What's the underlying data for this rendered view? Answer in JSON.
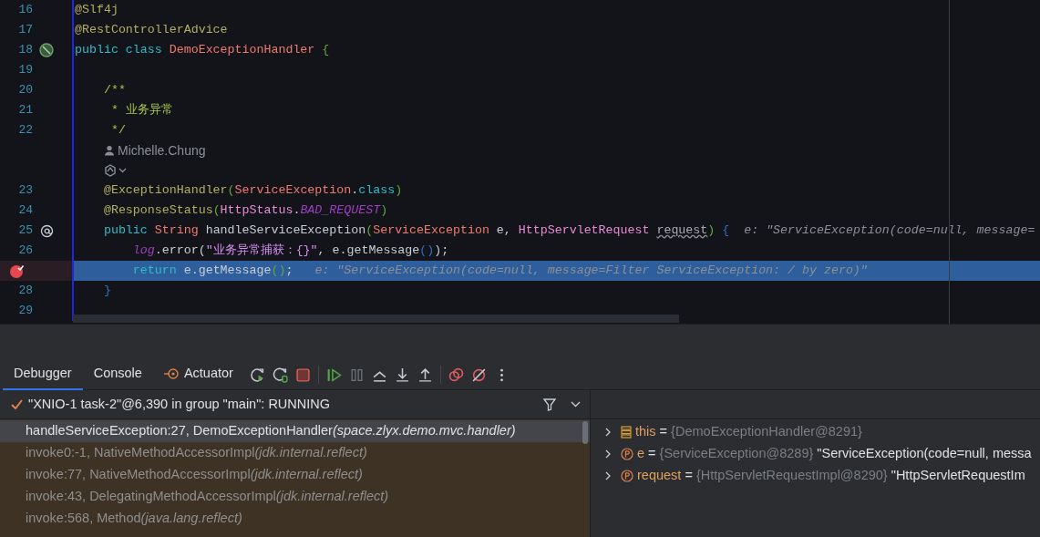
{
  "editor": {
    "lines": [
      {
        "kind": "code",
        "number": "16",
        "tokens": [
          {
            "text": "@Slf4j",
            "kind": "annotation"
          }
        ]
      },
      {
        "kind": "code",
        "number": "17",
        "tokens": [
          {
            "text": "@RestControllerAdvice",
            "kind": "annotation"
          }
        ]
      },
      {
        "kind": "class-declaration",
        "number": "18",
        "tokens": [
          {
            "text": "public class ",
            "kind": "keyword"
          },
          {
            "text": "DemoExceptionHandler",
            "kind": "type"
          },
          {
            "text": " {",
            "kind": "brace"
          }
        ]
      },
      {
        "kind": "code",
        "number": "19"
      },
      {
        "kind": "code",
        "number": "20",
        "tokens": [
          {
            "text": "    /**",
            "kind": "comment"
          }
        ]
      },
      {
        "kind": "code",
        "number": "21",
        "tokens": [
          {
            "text": "     * 业务异常",
            "kind": "comment"
          }
        ]
      },
      {
        "kind": "code",
        "number": "22",
        "tokens": [
          {
            "text": "     */",
            "kind": "comment"
          }
        ]
      },
      {
        "kind": "author",
        "text": "Michelle.Chung"
      },
      {
        "kind": "ai-hint"
      },
      {
        "kind": "code",
        "number": "23",
        "tokens": [
          {
            "text": "    @ExceptionHandler",
            "kind": "annotation"
          },
          {
            "text": "(",
            "kind": "brace"
          },
          {
            "text": "ServiceException",
            "kind": "type"
          },
          {
            "text": ".",
            "kind": "plain"
          },
          {
            "text": "class",
            "kind": "keyword"
          },
          {
            "text": ")",
            "kind": "brace"
          }
        ]
      },
      {
        "kind": "code",
        "number": "24",
        "tokens": [
          {
            "text": "    @ResponseStatus",
            "kind": "annotation"
          },
          {
            "text": "(",
            "kind": "brace"
          },
          {
            "text": "HttpStatus",
            "kind": "type2"
          },
          {
            "text": ".",
            "kind": "plain"
          },
          {
            "text": "BAD_REQUEST",
            "kind": "constant"
          },
          {
            "text": ")",
            "kind": "brace"
          }
        ]
      },
      {
        "kind": "request-mapping",
        "number": "25",
        "tokens": [
          {
            "text": "    public ",
            "kind": "keyword"
          },
          {
            "text": "String",
            "kind": "type"
          },
          {
            "text": " handleServiceException",
            "kind": "plain"
          },
          {
            "text": "(",
            "kind": "brace"
          },
          {
            "text": "ServiceException",
            "kind": "type"
          },
          {
            "text": " e, ",
            "kind": "plain"
          },
          {
            "text": "HttpServletRequest ",
            "kind": "type2"
          },
          {
            "text": "request",
            "kind": "unused"
          },
          {
            "text": ")",
            "kind": "brace"
          },
          {
            "text": " {",
            "kind": "brace2"
          },
          {
            "text": "  e: \"ServiceException(code=null, message=",
            "kind": "hint"
          }
        ]
      },
      {
        "kind": "code",
        "number": "26",
        "tokens": [
          {
            "text": "        log",
            "kind": "constant"
          },
          {
            "text": ".error(",
            "kind": "plain"
          },
          {
            "text": "\"业务异常捕获：{}\"",
            "kind": "string"
          },
          {
            "text": ", e.getMessage",
            "kind": "plain"
          },
          {
            "text": "()",
            "kind": "brace2"
          },
          {
            "text": ");",
            "kind": "plain"
          }
        ]
      },
      {
        "kind": "code",
        "current": true,
        "breakpoint": true,
        "tokens": [
          {
            "text": "        return",
            "kind": "keyword"
          },
          {
            "text": " e.getMessage",
            "kind": "plain"
          },
          {
            "text": "()",
            "kind": "brace"
          },
          {
            "text": ";",
            "kind": "plain"
          },
          {
            "text": "   e: \"ServiceException(code=null, message=Filter ServiceException: / by zero)\"",
            "kind": "hint"
          }
        ]
      },
      {
        "kind": "code",
        "number": "28",
        "tokens": [
          {
            "text": "    }",
            "kind": "brace2"
          }
        ]
      },
      {
        "kind": "code",
        "number": "29"
      }
    ]
  },
  "tool_window": {
    "tabs": [
      {
        "label": "Debugger",
        "selected": true
      },
      {
        "label": "Console",
        "selected": false
      },
      {
        "label": "Actuator",
        "selected": false
      }
    ],
    "thread": "\"XNIO-1 task-2\"@6,390 in group \"main\": RUNNING",
    "frames": [
      {
        "method": "handleServiceException:27, DemoExceptionHandler",
        "package": "(space.zlyx.demo.mvc.handler)",
        "selected": true,
        "library": false
      },
      {
        "method": "invoke0:-1, NativeMethodAccessorImpl",
        "package": "(jdk.internal.reflect)",
        "selected": false,
        "library": true
      },
      {
        "method": "invoke:77, NativeMethodAccessorImpl",
        "package": "(jdk.internal.reflect)",
        "selected": false,
        "library": true
      },
      {
        "method": "invoke:43, DelegatingMethodAccessorImpl",
        "package": "(jdk.internal.reflect)",
        "selected": false,
        "library": true
      },
      {
        "method": "invoke:568, Method",
        "package": "(java.lang.reflect)",
        "selected": false,
        "library": true
      }
    ],
    "variables": [
      {
        "kind": "this",
        "name": "this",
        "separator": "=",
        "type": "{DemoExceptionHandler@8291}"
      },
      {
        "kind": "param",
        "name": "e",
        "separator": "=",
        "type": "{ServiceException@8289}",
        "value": "\"ServiceException(code=null, messa"
      },
      {
        "kind": "param",
        "name": "request",
        "separator": "=",
        "type": "{HttpServletRequestImpl@8290}",
        "value": "\"HttpServletRequestIm"
      }
    ]
  }
}
